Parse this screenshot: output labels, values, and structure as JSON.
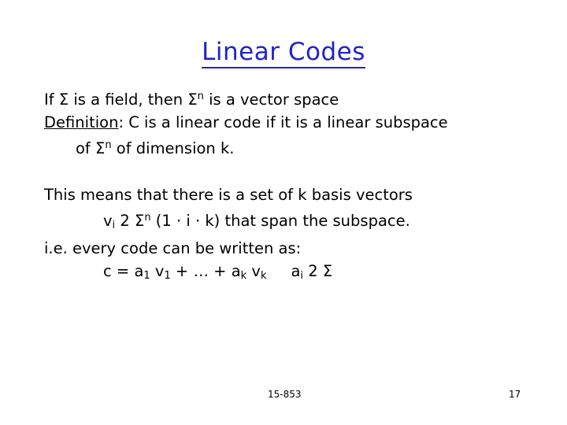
{
  "slide": {
    "title": "Linear Codes",
    "lines": [
      {
        "id": "l1",
        "parts": [
          {
            "t": "If "
          },
          {
            "t": "Σ",
            "style": "normal"
          },
          {
            "t": " is a field, then "
          },
          {
            "t": "Σ",
            "style": "normal"
          },
          {
            "t": "n",
            "style": "sup"
          },
          {
            "t": " is a vector space"
          }
        ]
      },
      {
        "id": "l2",
        "parts": [
          {
            "t": "Definition",
            "style": "underline"
          },
          {
            "t": ": C is a linear code if it is a linear subspace"
          }
        ]
      },
      {
        "id": "l3",
        "indent": "indent2",
        "parts": [
          {
            "t": "of "
          },
          {
            "t": "Σ",
            "style": "normal"
          },
          {
            "t": "n",
            "style": "sup"
          },
          {
            "t": " of dimension k."
          }
        ]
      },
      {
        "id": "gap1",
        "gap": true
      },
      {
        "id": "l4",
        "parts": [
          {
            "t": "This means that there is a set of k basis vectors"
          }
        ]
      },
      {
        "id": "l5",
        "indent": "indent3",
        "parts": [
          {
            "t": "v"
          },
          {
            "t": "i",
            "style": "sub"
          },
          {
            "t": " 2 "
          },
          {
            "t": "Σ",
            "style": "normal"
          },
          {
            "t": "n",
            "style": "sup"
          },
          {
            "t": " (1 · i · k) that span the subspace."
          }
        ]
      },
      {
        "id": "l6",
        "parts": [
          {
            "t": "i.e. every code can be written as:"
          }
        ]
      },
      {
        "id": "l7",
        "indent": "indent3",
        "parts": [
          {
            "t": "c = a"
          },
          {
            "t": "1",
            "style": "sub"
          },
          {
            "t": " v"
          },
          {
            "t": "1",
            "style": "sub"
          },
          {
            "t": " + … + a"
          },
          {
            "t": "k",
            "style": "sub"
          },
          {
            "t": " v"
          },
          {
            "t": "k",
            "style": "sub"
          },
          {
            "t": "     a"
          },
          {
            "t": "i",
            "style": "sub"
          },
          {
            "t": " 2 "
          },
          {
            "t": "Σ",
            "style": "normal"
          }
        ]
      }
    ],
    "footer_left": "15-853",
    "footer_right": "17",
    "title_color": "#2222cc",
    "text_color": "#000000",
    "background": "#ffffff"
  }
}
